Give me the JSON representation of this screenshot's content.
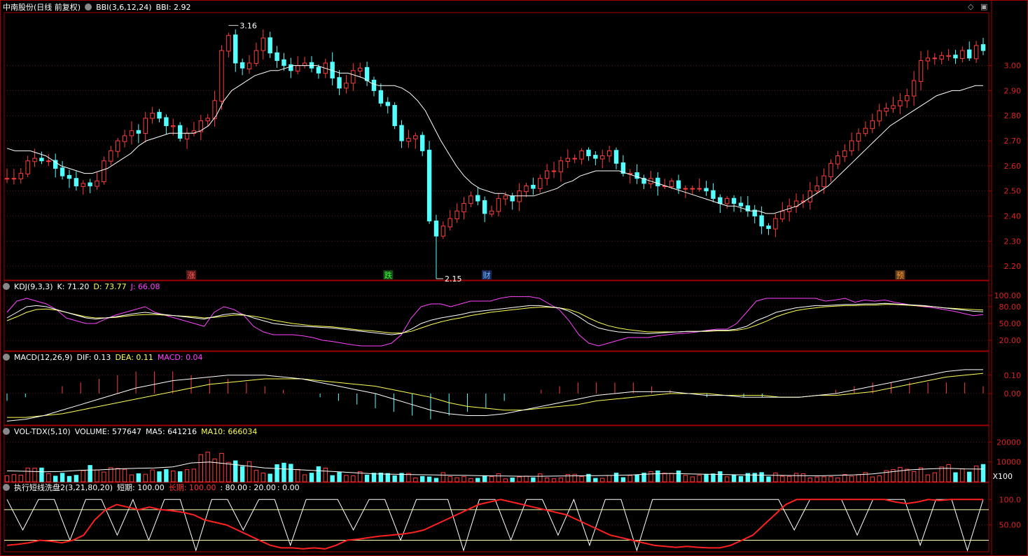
{
  "panels": {
    "main": {
      "title": "中南股份(日线 前复权)",
      "indicator": "BBI(3,6,12,24)",
      "indicator_value_label": "BBI: 2.92",
      "yticks": [
        "3.00",
        "2.90",
        "2.80",
        "2.70",
        "2.60",
        "2.50",
        "2.40",
        "2.30",
        "2.20"
      ],
      "high_label": "3.16",
      "low_label": "2.15",
      "markers": [
        {
          "text": "涨",
          "color": "#ff5a5a",
          "bg": "#5a1a1a"
        },
        {
          "text": "跌",
          "color": "#33ff33",
          "bg": "#1a4a1a"
        },
        {
          "text": "财",
          "color": "#6fb8ff",
          "bg": "#1a2a5a"
        },
        {
          "text": "预",
          "color": "#ff9933",
          "bg": "#5a3a1a"
        }
      ]
    },
    "kdj": {
      "name": "KDJ(9,3,3)",
      "k_label": "K: 71.20",
      "d_label": "D: 73.77",
      "j_label": "J: 66.08",
      "yticks": [
        "100.00",
        "80.00",
        "50.00",
        "20.00"
      ]
    },
    "macd": {
      "name": "MACD(12,26,9)",
      "dif_label": "DIF: 0.13",
      "dea_label": "DEA: 0.11",
      "macd_label": "MACD: 0.04",
      "yticks": [
        "0.10",
        "0.00"
      ]
    },
    "vol": {
      "name": "VOL-TDX(5,10)",
      "volume_label": "VOLUME: 577647",
      "ma5_label": "MA5: 641216",
      "ma10_label": "MA10: 666034",
      "yticks": [
        "20000",
        "10000"
      ],
      "unit": "X100"
    },
    "custom": {
      "name": "执行短线洗盘2(3,21,80,20)",
      "short_label": "短期: 100.00",
      "long_label": "长期: 100.00",
      "lvl1": ": 80.00",
      "lvl2": ": 20.00",
      "lvl3": ": 0.00",
      "yticks": [
        "100.0",
        "50.00"
      ]
    }
  },
  "colors": {
    "up": "#ff3c3c",
    "down": "#54ffff",
    "frame": "#a00000",
    "axis_text": "#dd2222",
    "kdj_k": "#ffffff",
    "kdj_d": "#ffff55",
    "kdj_j": "#ff44ff",
    "grid": "#552222"
  },
  "chart_data": {
    "type": "candlestick",
    "ylim": [
      2.15,
      3.2
    ],
    "close": [
      2.55,
      2.55,
      2.57,
      2.62,
      2.63,
      2.62,
      2.62,
      2.59,
      2.56,
      2.55,
      2.52,
      2.53,
      2.52,
      2.54,
      2.62,
      2.66,
      2.7,
      2.72,
      2.74,
      2.73,
      2.79,
      2.81,
      2.79,
      2.76,
      2.76,
      2.71,
      2.73,
      2.74,
      2.78,
      2.79,
      2.86,
      3.06,
      3.12,
      3.01,
      2.99,
      3.01,
      3.06,
      3.11,
      3.05,
      3.02,
      3.0,
      2.98,
      3.0,
      3.01,
      2.99,
      2.97,
      3.01,
      2.95,
      2.91,
      2.93,
      2.98,
      2.99,
      2.94,
      2.9,
      2.85,
      2.84,
      2.76,
      2.7,
      2.71,
      2.72,
      2.66,
      2.38,
      2.32,
      2.36,
      2.39,
      2.42,
      2.45,
      2.48,
      2.46,
      2.41,
      2.42,
      2.47,
      2.48,
      2.46,
      2.5,
      2.52,
      2.51,
      2.55,
      2.58,
      2.58,
      2.62,
      2.63,
      2.63,
      2.66,
      2.64,
      2.63,
      2.64,
      2.66,
      2.61,
      2.57,
      2.57,
      2.55,
      2.53,
      2.55,
      2.52,
      2.52,
      2.54,
      2.51,
      2.51,
      2.51,
      2.51,
      2.5,
      2.47,
      2.45,
      2.47,
      2.45,
      2.44,
      2.42,
      2.4,
      2.36,
      2.35,
      2.39,
      2.42,
      2.44,
      2.46,
      2.46,
      2.5,
      2.52,
      2.56,
      2.61,
      2.64,
      2.66,
      2.7,
      2.73,
      2.75,
      2.78,
      2.82,
      2.83,
      2.84,
      2.86,
      2.88,
      2.94,
      3.02,
      3.03,
      3.03,
      3.04,
      3.04,
      3.03,
      3.06,
      3.03,
      3.08,
      3.06
    ],
    "bbi": [
      2.67,
      2.66,
      2.66,
      2.66,
      2.65,
      2.64,
      2.62,
      2.6,
      2.59,
      2.58,
      2.57,
      2.57,
      2.58,
      2.59,
      2.61,
      2.63,
      2.65,
      2.68,
      2.7,
      2.71,
      2.72,
      2.73,
      2.73,
      2.73,
      2.73,
      2.74,
      2.76,
      2.8,
      2.86,
      2.9,
      2.92,
      2.94,
      2.96,
      2.97,
      2.98,
      2.98,
      2.99,
      3.0,
      3.0,
      3.0,
      3.0,
      2.99,
      2.98,
      2.97,
      2.97,
      2.96,
      2.95,
      2.93,
      2.92,
      2.92,
      2.92,
      2.91,
      2.89,
      2.86,
      2.82,
      2.76,
      2.7,
      2.65,
      2.6,
      2.56,
      2.53,
      2.51,
      2.5,
      2.49,
      2.49,
      2.48,
      2.48,
      2.48,
      2.48,
      2.49,
      2.5,
      2.51,
      2.53,
      2.54,
      2.56,
      2.57,
      2.58,
      2.58,
      2.58,
      2.58,
      2.57,
      2.56,
      2.55,
      2.54,
      2.53,
      2.52,
      2.51,
      2.5,
      2.49,
      2.48,
      2.47,
      2.46,
      2.45,
      2.44,
      2.44,
      2.43,
      2.42,
      2.42,
      2.41,
      2.41,
      2.42,
      2.43,
      2.44,
      2.46,
      2.48,
      2.5,
      2.52,
      2.55,
      2.58,
      2.61,
      2.64,
      2.67,
      2.7,
      2.73,
      2.76,
      2.78,
      2.8,
      2.82,
      2.84,
      2.86,
      2.88,
      2.89,
      2.9,
      2.9,
      2.91,
      2.92,
      2.92
    ],
    "kdj_k": [
      60,
      70,
      80,
      82,
      80,
      75,
      70,
      65,
      60,
      58,
      60,
      62,
      65,
      68,
      70,
      68,
      66,
      64,
      62,
      60,
      58,
      62,
      66,
      68,
      66,
      60,
      55,
      50,
      48,
      46,
      45,
      44,
      43,
      42,
      40,
      38,
      36,
      34,
      32,
      30,
      32,
      40,
      50,
      56,
      60,
      63,
      66,
      70,
      72,
      74,
      76,
      78,
      80,
      82,
      82,
      80,
      78,
      72,
      62,
      50,
      42,
      38,
      35,
      34,
      33,
      32,
      33,
      34,
      35,
      36,
      36,
      37,
      38,
      38,
      40,
      45,
      55,
      62,
      70,
      74,
      78,
      80,
      82,
      82,
      83,
      84,
      84,
      85,
      85,
      86,
      85,
      84,
      83,
      82,
      80,
      78,
      76,
      74,
      72,
      71
    ],
    "kdj_d": [
      55,
      62,
      70,
      75,
      76,
      74,
      70,
      66,
      62,
      60,
      60,
      61,
      63,
      65,
      66,
      66,
      65,
      64,
      63,
      62,
      60,
      61,
      63,
      65,
      65,
      63,
      60,
      56,
      53,
      50,
      48,
      46,
      45,
      44,
      42,
      40,
      38,
      37,
      35,
      33,
      33,
      36,
      42,
      48,
      53,
      57,
      60,
      64,
      67,
      70,
      72,
      74,
      76,
      78,
      79,
      79,
      78,
      75,
      69,
      60,
      52,
      46,
      42,
      39,
      37,
      35,
      35,
      35,
      35,
      36,
      36,
      36,
      37,
      37,
      38,
      41,
      47,
      54,
      62,
      68,
      73,
      76,
      78,
      80,
      81,
      82,
      82,
      83,
      83,
      84,
      84,
      83,
      82,
      81,
      80,
      78,
      77,
      76,
      75,
      74
    ],
    "kdj_j": [
      70,
      90,
      95,
      90,
      85,
      75,
      60,
      55,
      50,
      50,
      58,
      65,
      70,
      75,
      80,
      70,
      65,
      60,
      55,
      50,
      45,
      70,
      80,
      75,
      65,
      45,
      35,
      30,
      30,
      30,
      28,
      25,
      20,
      18,
      15,
      12,
      10,
      10,
      10,
      15,
      30,
      60,
      80,
      85,
      85,
      80,
      85,
      90,
      90,
      90,
      95,
      98,
      98,
      98,
      95,
      85,
      75,
      55,
      30,
      15,
      10,
      15,
      20,
      25,
      25,
      25,
      28,
      30,
      32,
      33,
      35,
      38,
      40,
      40,
      50,
      70,
      90,
      95,
      95,
      95,
      95,
      95,
      95,
      90,
      92,
      95,
      88,
      92,
      90,
      92,
      88,
      85,
      82,
      80,
      78,
      75,
      72,
      68,
      64,
      66
    ],
    "macd_dif": [
      -0.15,
      -0.14,
      -0.12,
      -0.09,
      -0.06,
      -0.03,
      0.0,
      0.03,
      0.05,
      0.07,
      0.08,
      0.09,
      0.1,
      0.1,
      0.1,
      0.09,
      0.08,
      0.06,
      0.04,
      0.02,
      0.0,
      -0.03,
      -0.06,
      -0.09,
      -0.11,
      -0.12,
      -0.12,
      -0.11,
      -0.09,
      -0.07,
      -0.05,
      -0.03,
      -0.01,
      0.0,
      0.01,
      0.01,
      0.01,
      0.0,
      -0.01,
      -0.01,
      -0.02,
      -0.02,
      -0.02,
      -0.02,
      -0.01,
      0.0,
      0.02,
      0.04,
      0.06,
      0.08,
      0.1,
      0.12,
      0.13,
      0.13
    ],
    "macd_dea": [
      -0.13,
      -0.13,
      -0.12,
      -0.11,
      -0.09,
      -0.07,
      -0.05,
      -0.03,
      -0.01,
      0.01,
      0.03,
      0.05,
      0.06,
      0.07,
      0.08,
      0.08,
      0.08,
      0.07,
      0.06,
      0.05,
      0.04,
      0.02,
      0.0,
      -0.02,
      -0.05,
      -0.07,
      -0.08,
      -0.09,
      -0.09,
      -0.08,
      -0.07,
      -0.06,
      -0.04,
      -0.03,
      -0.02,
      -0.01,
      0.0,
      0.0,
      0.0,
      -0.01,
      -0.01,
      -0.01,
      -0.02,
      -0.02,
      -0.01,
      -0.01,
      0.0,
      0.01,
      0.03,
      0.05,
      0.07,
      0.09,
      0.1,
      0.11
    ],
    "vol_ma5": [
      5500,
      5300,
      5000,
      5200,
      5800,
      6000,
      6500,
      6800,
      7000,
      7500,
      9500,
      10000,
      9000,
      8000,
      7000,
      6500,
      6000,
      5500,
      5000,
      4500,
      4000,
      3800,
      3600,
      3500,
      3300,
      3200,
      3000,
      2900,
      2800,
      2800,
      2900,
      3000,
      3100,
      3200,
      3500,
      4000,
      4200,
      4000,
      3800,
      3600,
      3500,
      3300,
      3200,
      3100,
      3000,
      3200,
      3500,
      4000,
      5000,
      6000,
      6500,
      6800,
      6500,
      6400
    ],
    "custom_short": [
      100,
      40,
      100,
      100,
      20,
      100,
      100,
      30,
      100,
      20,
      100,
      100,
      0,
      100,
      100,
      40,
      100,
      100,
      10,
      100,
      100,
      100,
      40,
      100,
      100,
      20,
      100,
      100,
      100,
      0,
      100,
      100,
      20,
      100,
      100,
      30,
      100,
      10,
      100,
      100,
      0,
      100,
      100,
      100,
      100,
      100,
      100,
      100,
      100,
      100,
      40,
      100,
      100,
      100,
      30,
      100,
      100,
      100,
      10,
      100,
      100,
      0,
      100
    ],
    "custom_long": [
      10,
      12,
      15,
      20,
      18,
      15,
      20,
      30,
      60,
      80,
      90,
      85,
      80,
      85,
      80,
      78,
      75,
      70,
      60,
      55,
      50,
      40,
      30,
      20,
      10,
      5,
      5,
      3,
      5,
      3,
      10,
      20,
      22,
      25,
      28,
      30,
      32,
      35,
      40,
      50,
      60,
      70,
      80,
      90,
      95,
      100,
      95,
      90,
      85,
      80,
      75,
      70,
      60,
      50,
      40,
      30,
      25,
      20,
      15,
      10,
      8,
      6,
      8,
      6,
      5,
      5,
      10,
      20,
      30,
      50,
      70,
      90,
      100,
      100,
      100,
      100,
      100,
      100,
      100,
      100,
      100,
      95,
      92,
      95,
      100,
      98,
      100,
      100,
      100,
      100
    ]
  }
}
